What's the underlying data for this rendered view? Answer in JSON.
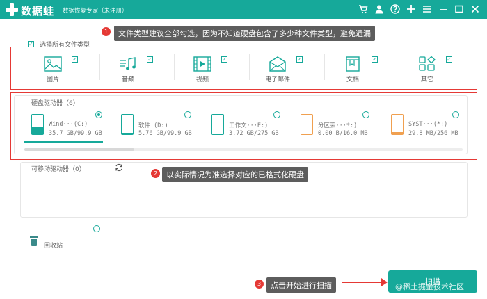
{
  "titlebar": {
    "brand": "数据蛙",
    "subtitle": "数据恢复专家（未注册）",
    "icons": [
      "cart-icon",
      "user-icon",
      "help-icon",
      "plus-icon",
      "menu-icon",
      "minimize-icon",
      "maximize-icon",
      "close-icon"
    ]
  },
  "callouts": [
    {
      "badge": "1",
      "text": "文件类型建议全部勾选，因为不知道硬盘包含了多少种文件类型，避免遗漏"
    },
    {
      "badge": "2",
      "text": "以实际情况为准选择对应的已格式化硬盘"
    },
    {
      "badge": "3",
      "text": "点击开始进行扫描"
    }
  ],
  "select_all": {
    "label": "选择所有文件类型",
    "checked": true
  },
  "file_types": [
    {
      "label": "图片",
      "icon": "image-icon",
      "checked": true
    },
    {
      "label": "音频",
      "icon": "music-icon",
      "checked": true
    },
    {
      "label": "视频",
      "icon": "video-icon",
      "checked": true
    },
    {
      "label": "电子邮件",
      "icon": "email-icon",
      "checked": true
    },
    {
      "label": "文档",
      "icon": "document-icon",
      "checked": true
    },
    {
      "label": "其它",
      "icon": "other-icon",
      "checked": true
    }
  ],
  "drives_section": {
    "title": "硬盘驱动器（6）"
  },
  "drives": [
    {
      "name": "Wind···(C:)",
      "size": "35.7 GB/99.9 GB",
      "selected": true,
      "usage": 0.36,
      "color": "#16a99a"
    },
    {
      "name": "软件 (D:)",
      "size": "5.76 GB/99.9 GB",
      "selected": false,
      "usage": 0.06,
      "color": "#16a99a"
    },
    {
      "name": "工作文···E:)",
      "size": "3.72 GB/275 GB",
      "selected": false,
      "usage": 0.02,
      "color": "#16a99a"
    },
    {
      "name": "分区丢···*:)",
      "size": "0.00  B/16.0 MB",
      "selected": false,
      "usage": 0.0,
      "color": "#f0a050"
    },
    {
      "name": "SYST···(*:)",
      "size": "29.8 MB/256 MB",
      "selected": false,
      "usage": 0.12,
      "color": "#f0a050"
    }
  ],
  "drives_scroll": 0.25,
  "removable_section": {
    "title": "可移动驱动器（0）"
  },
  "recycle": {
    "label": "回收站",
    "selected": false
  },
  "scan_button": {
    "label": "扫描"
  },
  "watermark": "@稀土掘金技术社区"
}
